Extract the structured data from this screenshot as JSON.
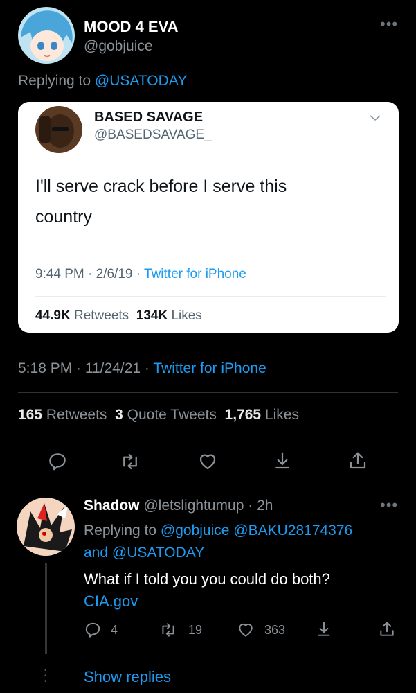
{
  "tweet": {
    "display_name": "MOOD 4 EVA",
    "handle": "@gobjuice",
    "reply_prefix": "Replying to",
    "reply_target": "@USATODAY",
    "time": "5:18 PM · 11/24/21 ·",
    "source": "Twitter for iPhone",
    "stats": {
      "retweets_count": "165",
      "retweets_label": "Retweets",
      "quotes_count": "3",
      "quotes_label": "Quote Tweets",
      "likes_count": "1,765",
      "likes_label": "Likes"
    }
  },
  "quoted_tweet": {
    "display_name": "BASED SAVAGE",
    "handle": "@BASEDSAVAGE_",
    "text_line1": "I'll serve crack before I serve this",
    "text_line2": "country",
    "time": "9:44 PM · 2/6/19 ·",
    "source": "Twitter for iPhone",
    "retweets_count": "44.9K",
    "retweets_label": "Retweets",
    "likes_count": "134K",
    "likes_label": "Likes"
  },
  "reply": {
    "display_name": "Shadow",
    "handle_time": "@letslightumup · 2h",
    "reply_prefix": "Replying to",
    "reply_targets_line1": "@gobjuice @BAKU28174376",
    "reply_and": "and",
    "reply_target_last": "@USATODAY",
    "text": "What if I told you you could do both?",
    "link": "CIA.gov",
    "reply_count": "4",
    "retweet_count": "19",
    "like_count": "363"
  },
  "show_replies": "Show replies",
  "icons": {
    "more": "more-icon",
    "reply": "reply-icon",
    "retweet": "retweet-icon",
    "like": "heart-icon",
    "bookmark": "bookmark-icon",
    "share": "share-icon",
    "chevron": "chevron-down-icon"
  },
  "colors": {
    "accent": "#1d9bf0",
    "background": "#000000",
    "text": "#e7e9ea",
    "muted": "#8b9298"
  }
}
